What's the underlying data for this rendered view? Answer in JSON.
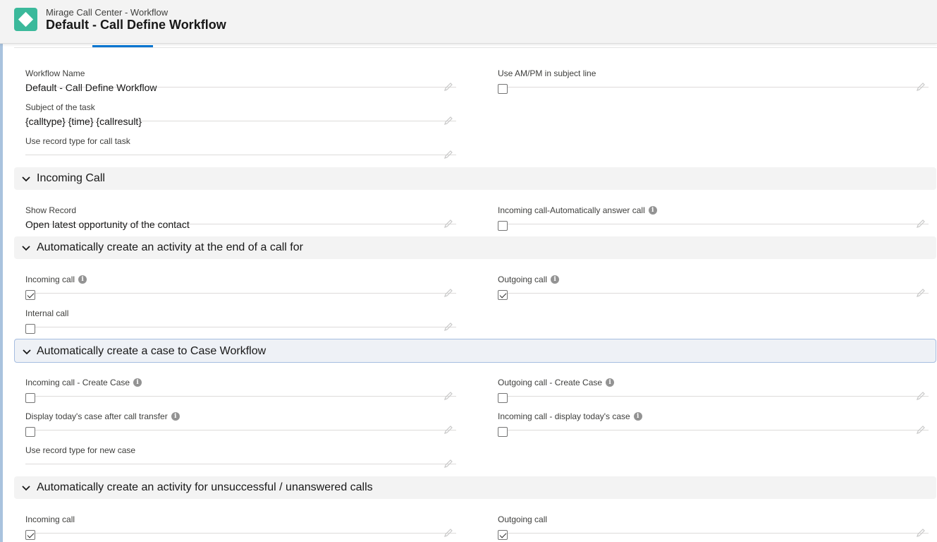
{
  "header": {
    "breadcrumb": "Mirage Call Center - Workflow",
    "title": "Default - Call Define Workflow"
  },
  "general": {
    "workflow_name": {
      "label": "Workflow Name",
      "value": "Default - Call Define Workflow"
    },
    "use_ampm": {
      "label": "Use AM/PM in subject line",
      "checked": false
    },
    "subject": {
      "label": "Subject of the task",
      "value": "{calltype} {time} {callresult}"
    },
    "record_type_task": {
      "label": "Use record type for call task",
      "value": ""
    }
  },
  "incoming_call": {
    "title": "Incoming Call",
    "show_record": {
      "label": "Show Record",
      "value": "Open latest opportunity of the contact"
    },
    "auto_answer": {
      "label": "Incoming call-Automatically answer call",
      "checked": false
    }
  },
  "activity_end": {
    "title": "Automatically create an activity at the end of a call for",
    "incoming": {
      "label": "Incoming call",
      "checked": true
    },
    "outgoing": {
      "label": "Outgoing call",
      "checked": true
    },
    "internal": {
      "label": "Internal call",
      "checked": false
    }
  },
  "case_workflow": {
    "title": "Automatically create a case to Case Workflow",
    "incoming_create": {
      "label": "Incoming call - Create Case",
      "checked": false
    },
    "outgoing_create": {
      "label": "Outgoing call - Create Case",
      "checked": false
    },
    "display_after_transfer": {
      "label": "Display today's case after call transfer",
      "checked": false
    },
    "incoming_display": {
      "label": "Incoming call - display today's case",
      "checked": false
    },
    "record_type_case": {
      "label": "Use record type for new case",
      "value": ""
    }
  },
  "unsuccessful": {
    "title": "Automatically create an activity for unsuccessful / unanswered calls",
    "incoming": {
      "label": "Incoming call",
      "checked": true
    },
    "outgoing": {
      "label": "Outgoing call",
      "checked": true
    }
  }
}
